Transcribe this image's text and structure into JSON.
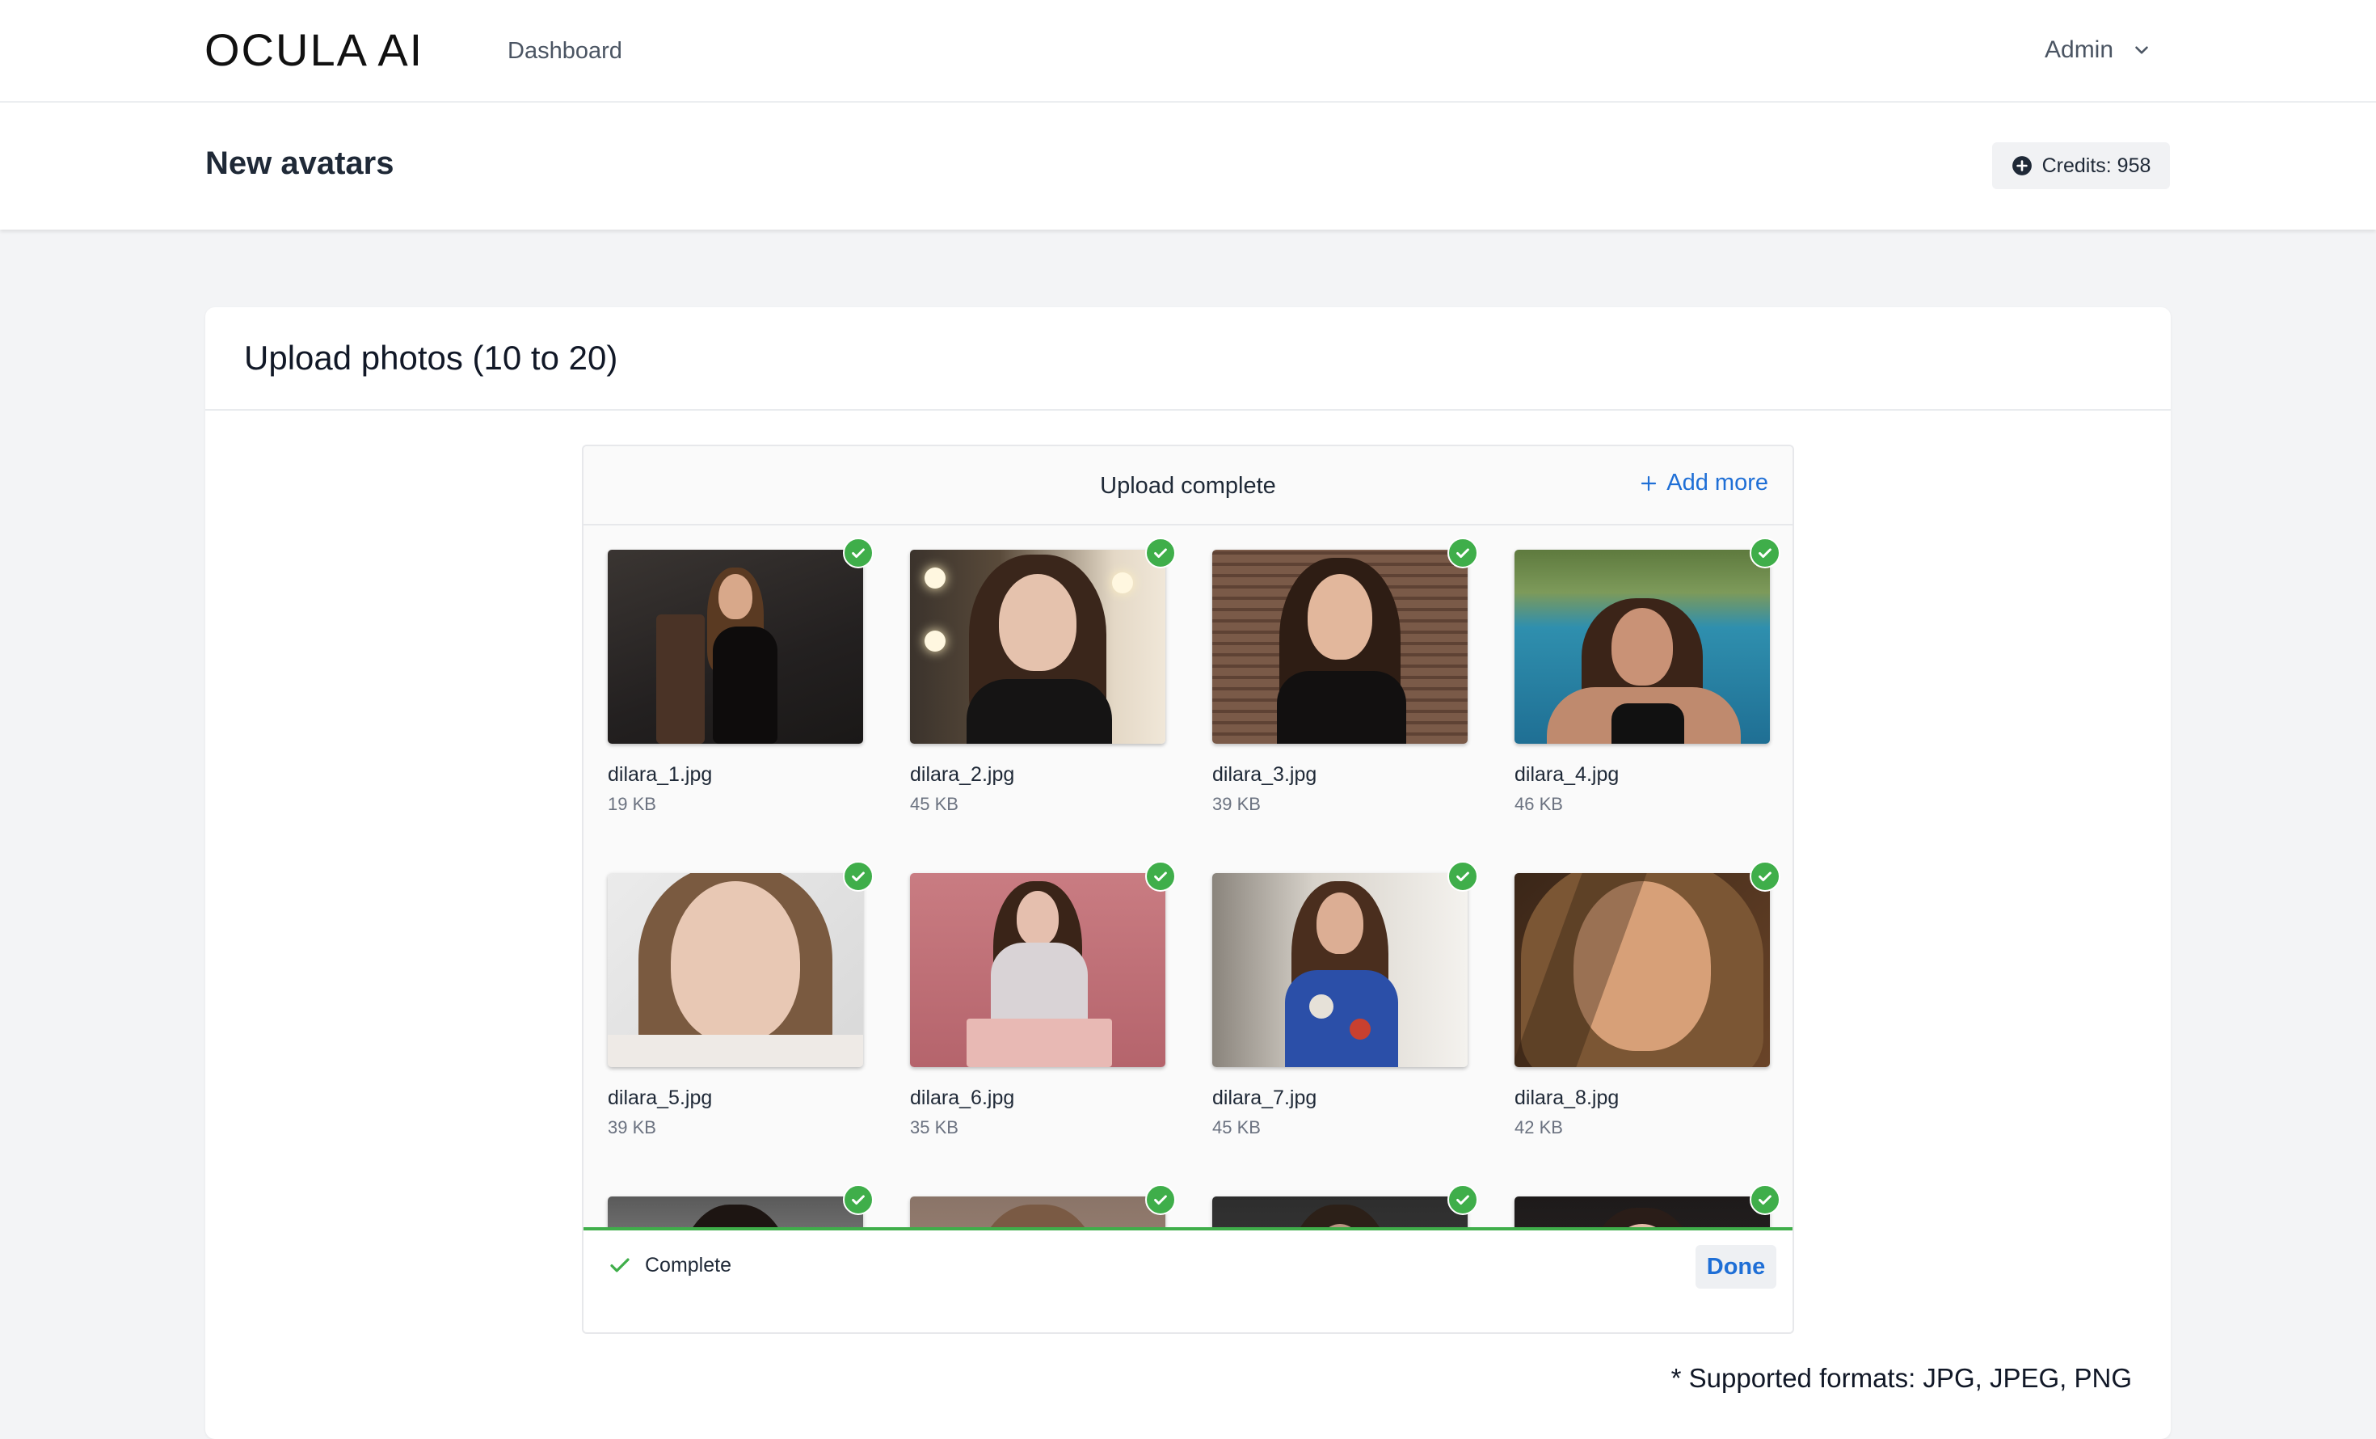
{
  "nav": {
    "logo": "OCULA AI",
    "dashboard": "Dashboard",
    "user": "Admin"
  },
  "header": {
    "title": "New avatars",
    "credits": "Credits: 958"
  },
  "card": {
    "title": "Upload photos (10 to 20)",
    "formats_note": "* Supported formats: JPG, JPEG, PNG"
  },
  "uploader": {
    "status": "Upload complete",
    "add_more": "Add more",
    "footer_status": "Complete",
    "done_label": "Done",
    "files": [
      {
        "name": "dilara_1.jpg",
        "size": "19 KB"
      },
      {
        "name": "dilara_2.jpg",
        "size": "45 KB"
      },
      {
        "name": "dilara_3.jpg",
        "size": "39 KB"
      },
      {
        "name": "dilara_4.jpg",
        "size": "46 KB"
      },
      {
        "name": "dilara_5.jpg",
        "size": "39 KB"
      },
      {
        "name": "dilara_6.jpg",
        "size": "35 KB"
      },
      {
        "name": "dilara_7.jpg",
        "size": "45 KB"
      },
      {
        "name": "dilara_8.jpg",
        "size": "42 KB"
      },
      {
        "name": "",
        "size": ""
      },
      {
        "name": "",
        "size": ""
      },
      {
        "name": "",
        "size": ""
      },
      {
        "name": "",
        "size": ""
      }
    ]
  },
  "colors": {
    "accent": "#1f6fd6",
    "success": "#3fae4a"
  }
}
